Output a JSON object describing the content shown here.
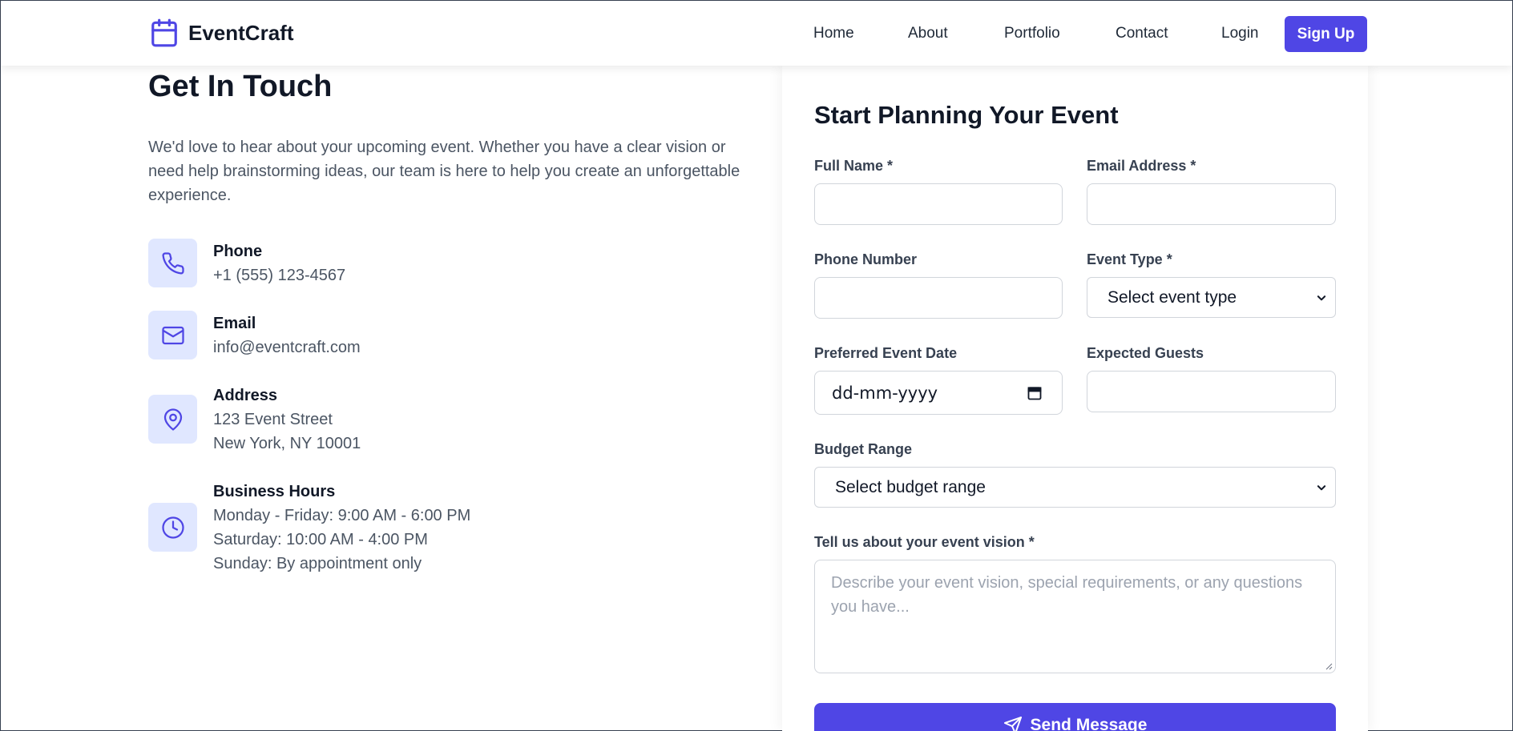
{
  "brand": {
    "name": "EventCraft",
    "icon": "calendar-icon",
    "accent": "#4f46e5"
  },
  "nav": {
    "home": "Home",
    "about": "About",
    "portfolio": "Portfolio",
    "contact": "Contact",
    "login": "Login",
    "signup": "Sign Up"
  },
  "contact_info": {
    "title": "Get In Touch",
    "intro": "We'd love to hear about your upcoming event. Whether you have a clear vision or need help brainstorming ideas, our team is here to help you create an unforgettable experience.",
    "phone": {
      "icon": "phone-icon",
      "label": "Phone",
      "value": "+1 (555) 123-4567"
    },
    "email": {
      "icon": "mail-icon",
      "label": "Email",
      "value": "info@eventcraft.com"
    },
    "address": {
      "icon": "map-pin-icon",
      "label": "Address",
      "line1": "123 Event Street",
      "line2": "New York, NY 10001"
    },
    "hours": {
      "icon": "clock-icon",
      "label": "Business Hours",
      "line1": "Monday - Friday: 9:00 AM - 6:00 PM",
      "line2": "Saturday: 10:00 AM - 4:00 PM",
      "line3": "Sunday: By appointment only"
    }
  },
  "form": {
    "title": "Start Planning Your Event",
    "full_name_label": "Full Name *",
    "full_name_value": "",
    "email_label": "Email Address *",
    "email_value": "",
    "phone_label": "Phone Number",
    "phone_value": "",
    "event_type_label": "Event Type *",
    "event_type_selected": "Select event type",
    "date_label": "Preferred Event Date",
    "date_placeholder": "dd-mm-yyyy",
    "guests_label": "Expected Guests",
    "guests_value": "",
    "budget_label": "Budget Range",
    "budget_selected": "Select budget range",
    "vision_label": "Tell us about your event vision *",
    "vision_placeholder": "Describe your event vision, special requirements, or any questions you have...",
    "submit_label": "Send Message",
    "submit_icon": "send-icon"
  }
}
